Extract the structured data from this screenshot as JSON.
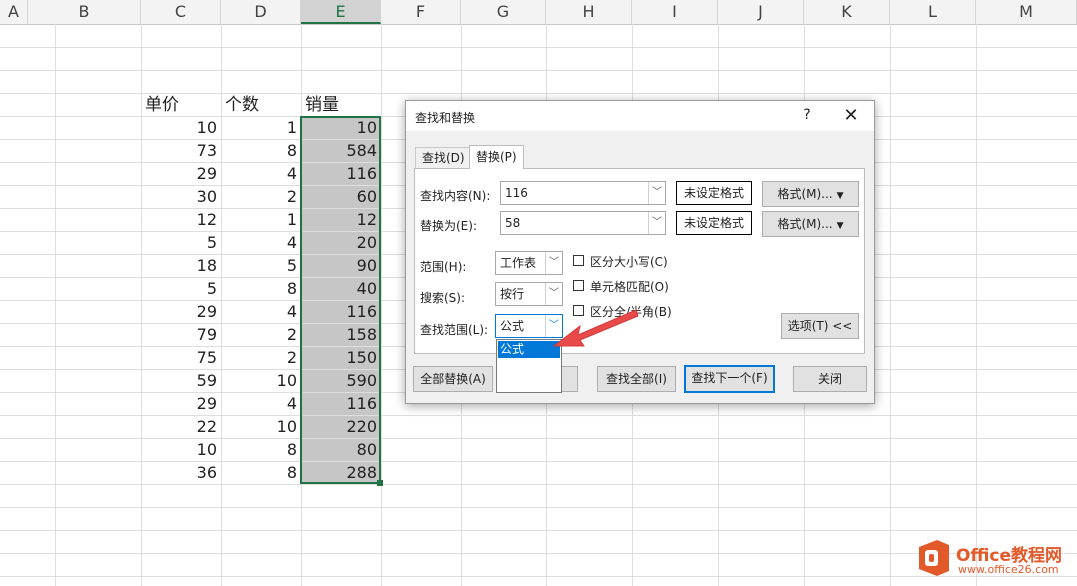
{
  "spreadsheet": {
    "columns": [
      "A",
      "B",
      "C",
      "D",
      "E",
      "F",
      "G",
      "H",
      "I",
      "J",
      "K",
      "L",
      "M"
    ],
    "active_column": "E",
    "headers": {
      "c": "单价",
      "d": "个数",
      "e": "销量"
    },
    "rows": [
      {
        "c": "10",
        "d": "1",
        "e": "10"
      },
      {
        "c": "73",
        "d": "8",
        "e": "584"
      },
      {
        "c": "29",
        "d": "4",
        "e": "116"
      },
      {
        "c": "30",
        "d": "2",
        "e": "60"
      },
      {
        "c": "12",
        "d": "1",
        "e": "12"
      },
      {
        "c": "5",
        "d": "4",
        "e": "20"
      },
      {
        "c": "18",
        "d": "5",
        "e": "90"
      },
      {
        "c": "5",
        "d": "8",
        "e": "40"
      },
      {
        "c": "29",
        "d": "4",
        "e": "116"
      },
      {
        "c": "79",
        "d": "2",
        "e": "158"
      },
      {
        "c": "75",
        "d": "2",
        "e": "150"
      },
      {
        "c": "59",
        "d": "10",
        "e": "590"
      },
      {
        "c": "29",
        "d": "4",
        "e": "116"
      },
      {
        "c": "22",
        "d": "10",
        "e": "220"
      },
      {
        "c": "10",
        "d": "8",
        "e": "80"
      },
      {
        "c": "36",
        "d": "8",
        "e": "288"
      }
    ]
  },
  "dialog": {
    "title": "查找和替换",
    "help_label": "?",
    "close_label": "✕",
    "tabs": {
      "find": "查找(D)",
      "replace": "替换(P)"
    },
    "find_label": "查找内容(N):",
    "find_value": "116",
    "replace_label": "替换为(E):",
    "replace_value": "58",
    "format_status": "未设定格式",
    "format_button": "格式(M)...",
    "scope_label": "范围(H):",
    "scope_value": "工作表",
    "search_label": "搜索(S):",
    "search_value": "按行",
    "lookin_label": "查找范围(L):",
    "lookin_value": "公式",
    "lookin_option_selected": "公式",
    "match_case": "区分大小写(C)",
    "match_cell": "单元格匹配(O)",
    "match_width": "区分全/半角(B)",
    "options_button": "选项(T) <<",
    "replace_all": "全部替换(A)",
    "find_all": "查找全部(I)",
    "find_next": "查找下一个(F)",
    "close_button": "关闭"
  },
  "watermark": {
    "name": "Office教程网",
    "url": "www.office26.com"
  },
  "colors": {
    "excel_green": "#217346",
    "accent_blue": "#0078d7",
    "arrow_red": "#e84a4a",
    "logo_orange": "#e2592a"
  }
}
